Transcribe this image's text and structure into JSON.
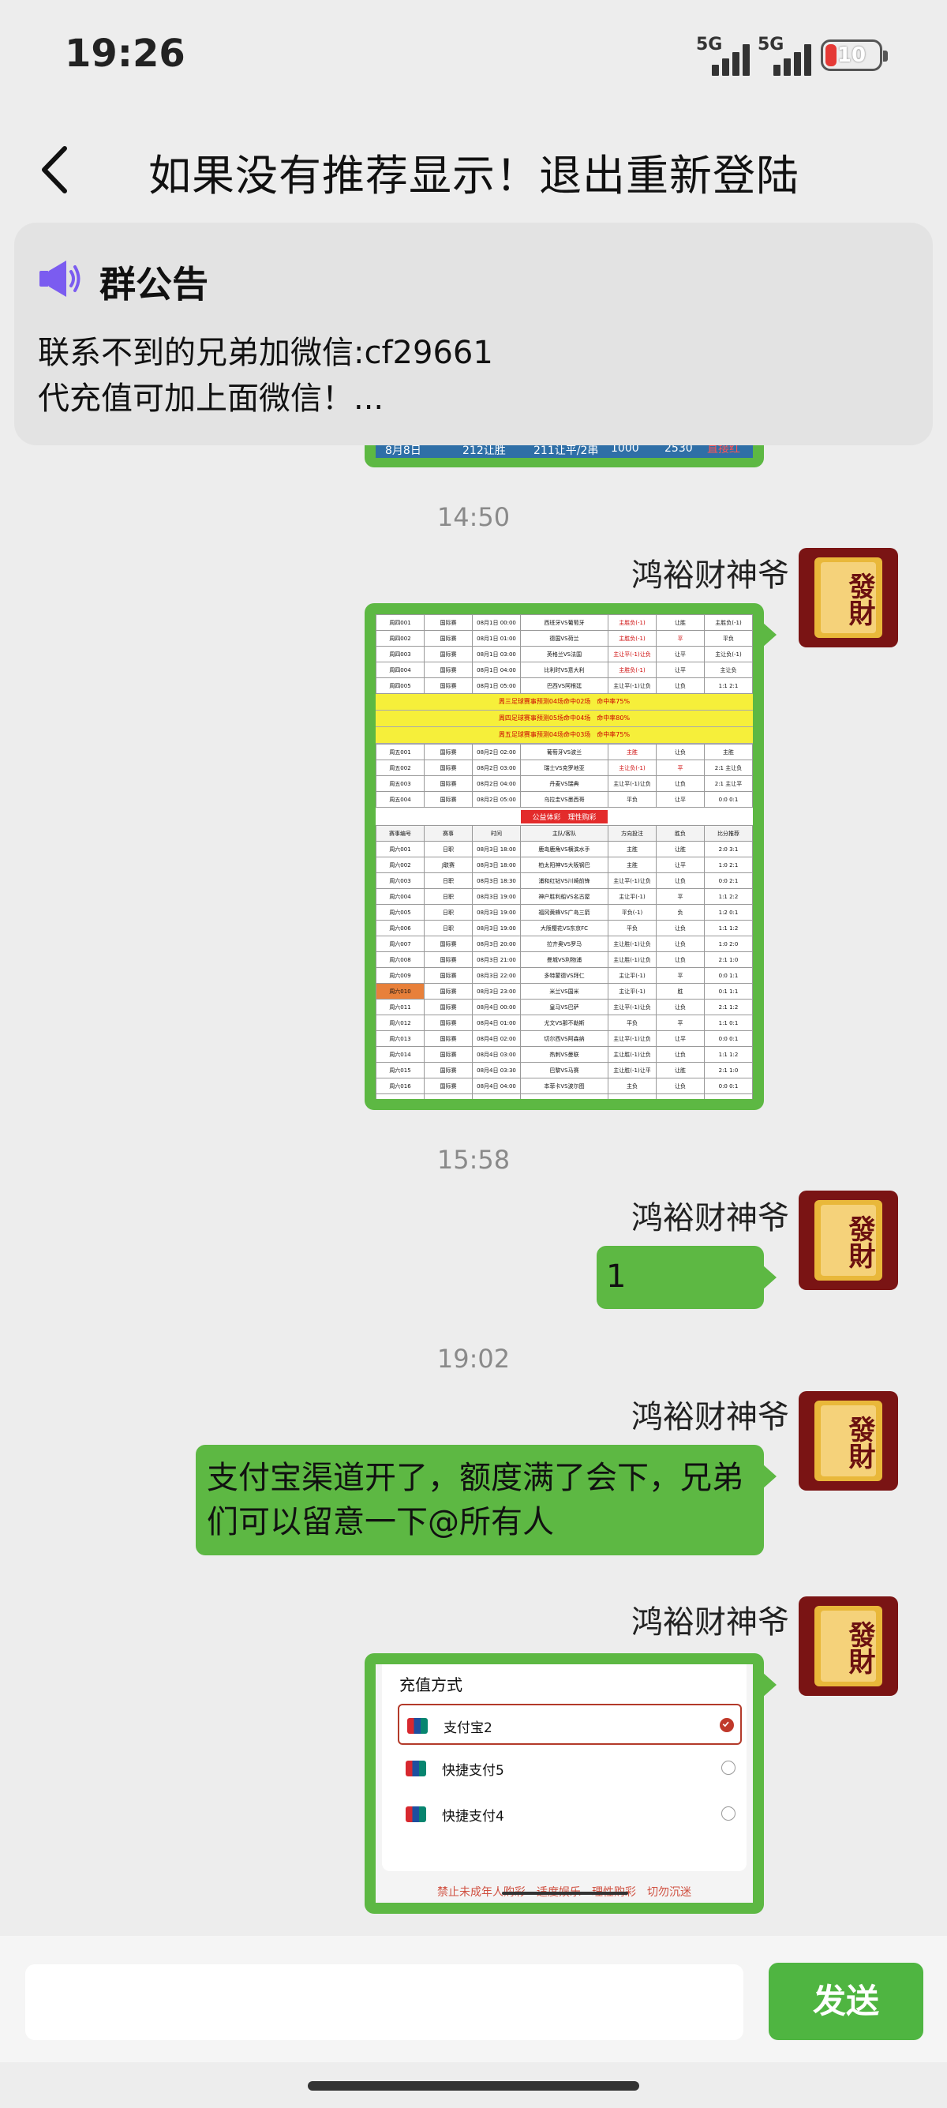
{
  "status_bar": {
    "time": "19:26",
    "sim1": "5G",
    "sim2": "5G",
    "battery": "10"
  },
  "nav": {
    "title": "如果没有推荐显示！退出重新登陆"
  },
  "notice": {
    "title": "群公告",
    "line1": "联系不到的兄弟加微信:cf29661",
    "line2": "代充值可加上面微信！..."
  },
  "top_fragment": {
    "cells": [
      "8月8日",
      "212让胜",
      "211让平/2串",
      "1000",
      "2530",
      "直接红"
    ]
  },
  "messages": [
    {
      "time": "14:50",
      "sender": "鸿裕财神爷",
      "type": "image"
    },
    {
      "time": "15:58",
      "sender": "鸿裕财神爷",
      "type": "text",
      "text": "1"
    },
    {
      "time": "19:02",
      "sender": "鸿裕财神爷",
      "type": "text",
      "text": "支付宝渠道开了，额度满了会下，兄弟们可以留意一下@所有人"
    },
    {
      "sender": "鸿裕财神爷",
      "type": "image"
    }
  ],
  "avatar_text": "發財",
  "image_table": {
    "bands": [
      "周三足球赛事预测04场命中02场　命中率75%",
      "周四足球赛事预测05场命中04场　命中率80%",
      "周五足球赛事预测04场命中03场　命中率75%"
    ],
    "section_title": "公益体彩　理性购彩",
    "headers": [
      "赛事编号",
      "赛事",
      "时间",
      "主队/客队",
      "方向投注",
      "胜负",
      "比分推荐"
    ]
  },
  "pay_panel": {
    "title": "充值方式",
    "options": [
      {
        "label": "支付宝2",
        "selected": true
      },
      {
        "label": "快捷支付5",
        "selected": false
      },
      {
        "label": "快捷支付4",
        "selected": false
      }
    ],
    "footer": "禁止未成年人购彩　适度娱乐　理性购彩　切勿沉迷"
  },
  "input": {
    "send_label": "发送"
  },
  "colors": {
    "bubble": "#5db843",
    "send": "#4fb541",
    "notice_icon": "#7b5cf0"
  }
}
